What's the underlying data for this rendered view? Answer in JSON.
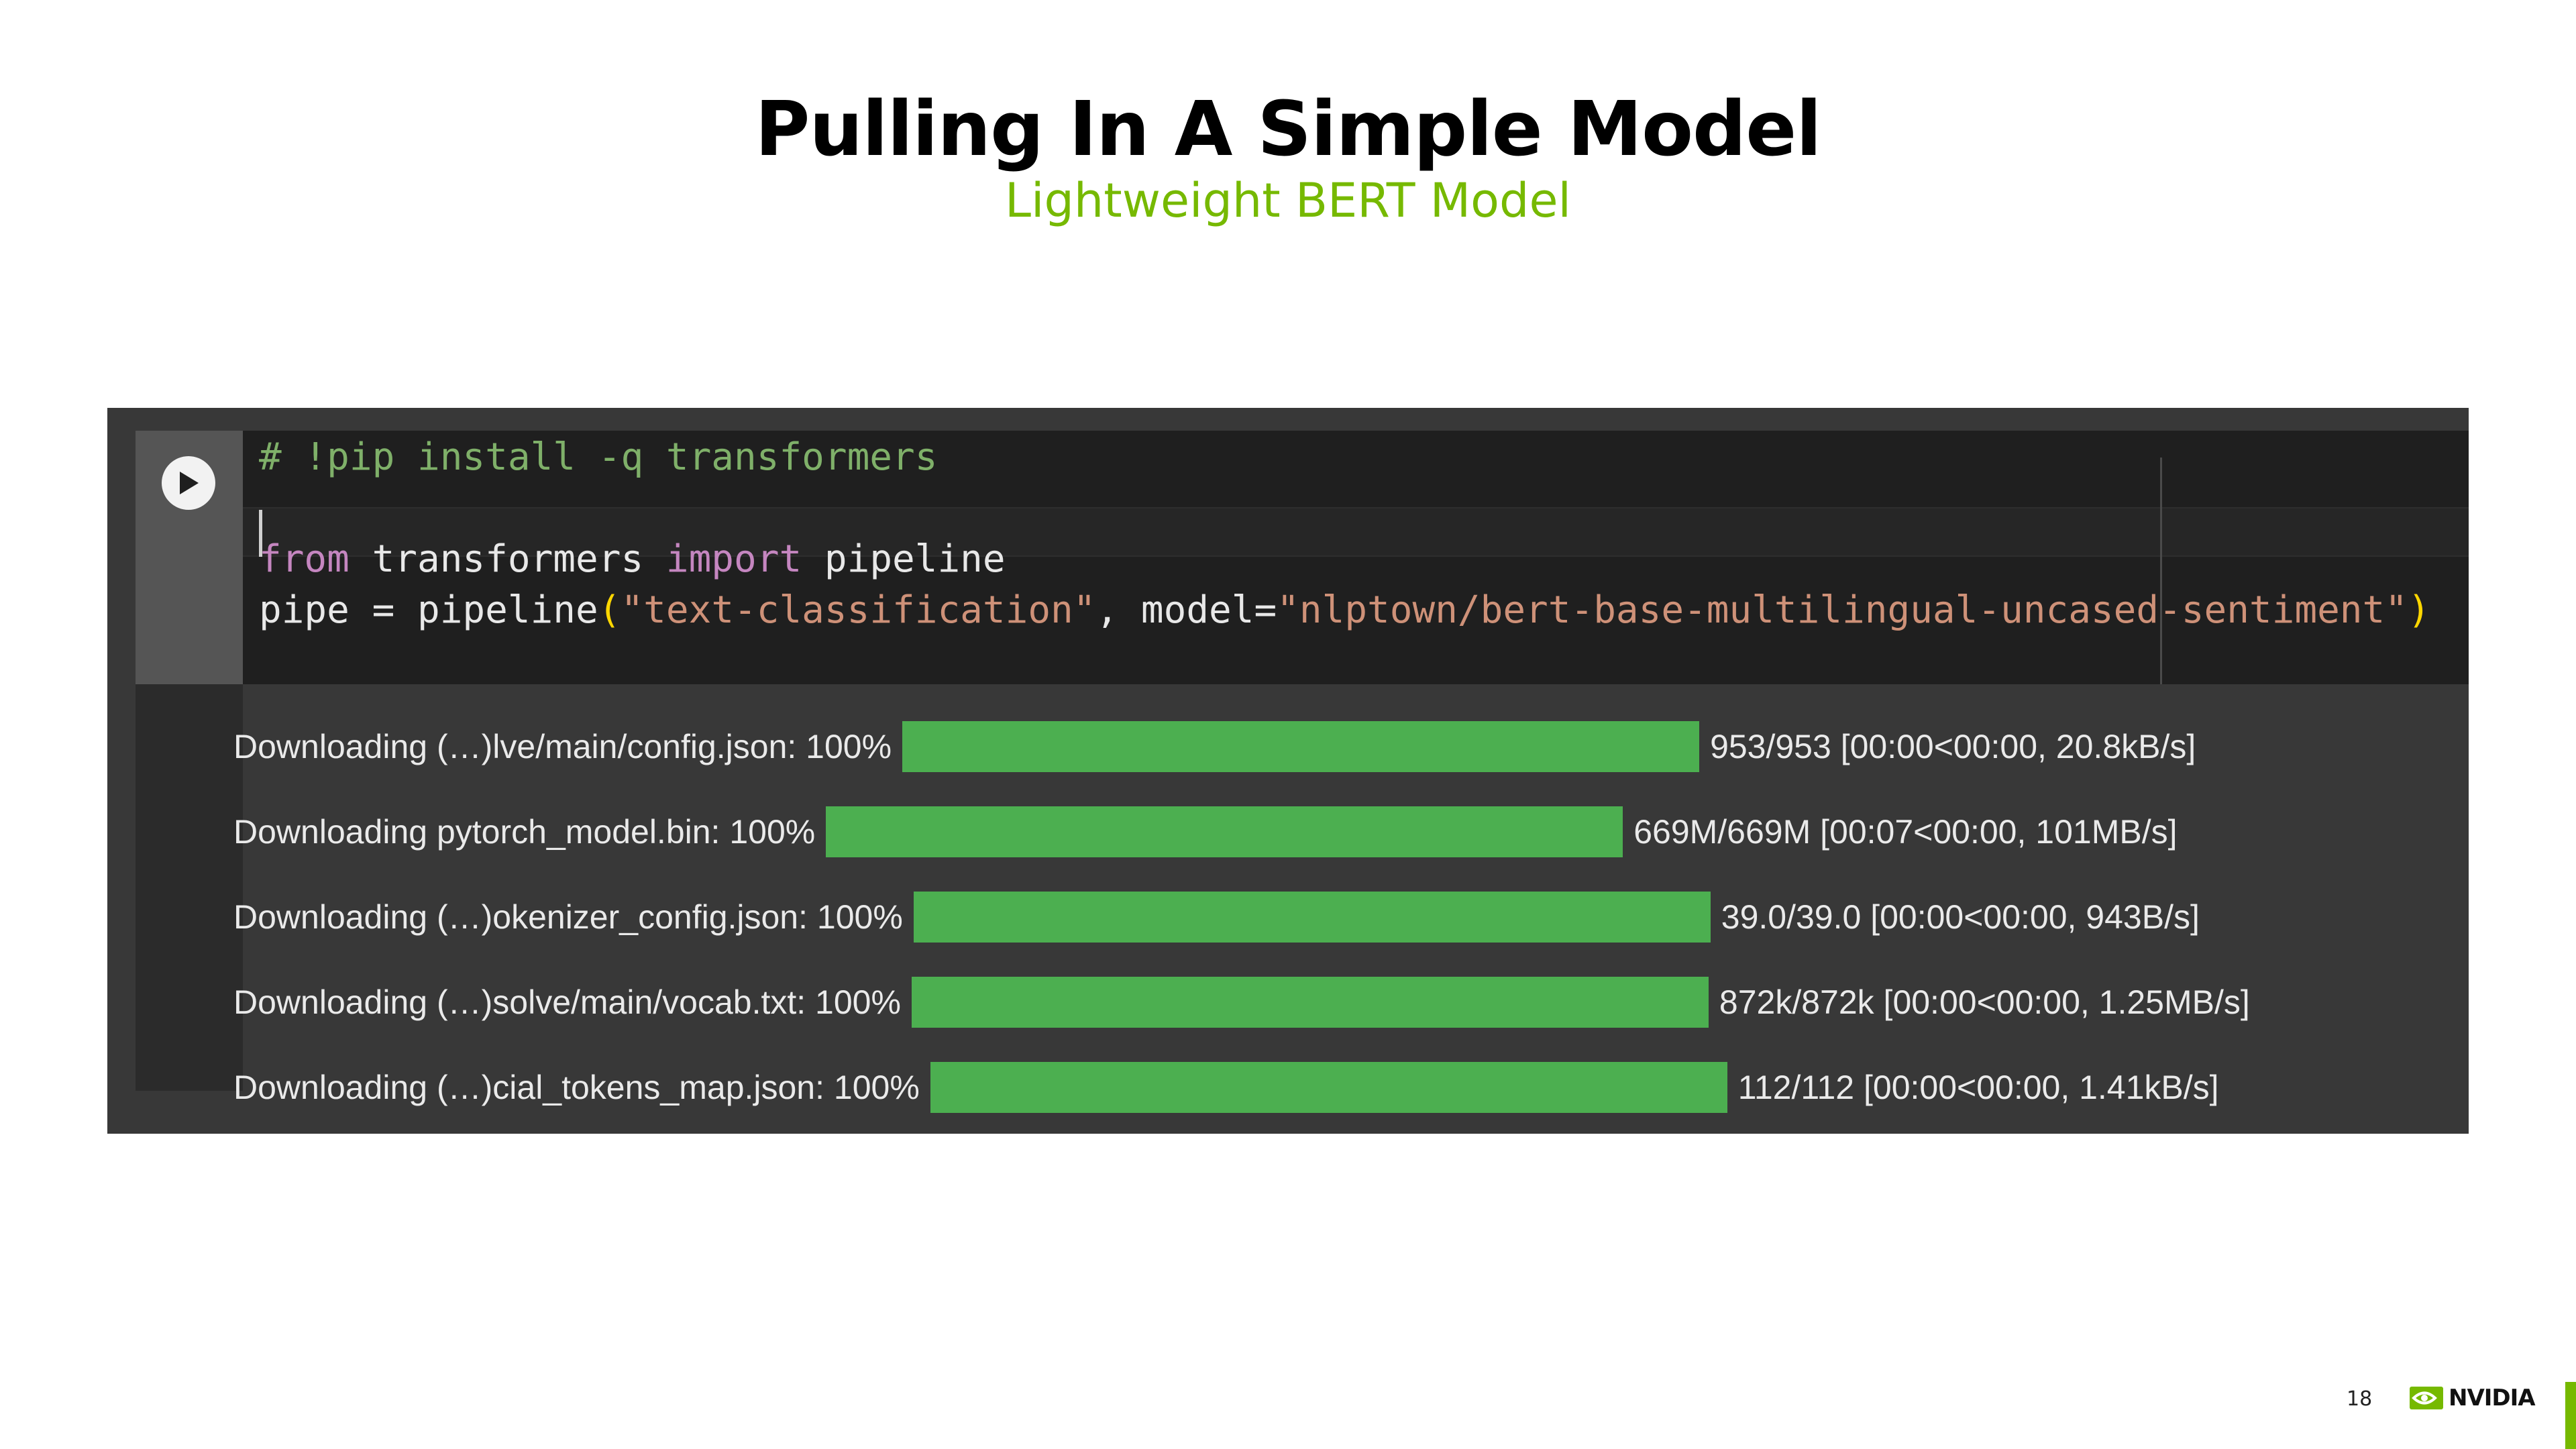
{
  "slide": {
    "title": "Pulling In A Simple Model",
    "subtitle": "Lightweight BERT Model",
    "page_number": "18",
    "logo_text": "NVIDIA",
    "accent_color": "#76b900"
  },
  "cell": {
    "run_icon": "play-icon",
    "code": {
      "line1": "# !pip install -q transformers",
      "line3_kw1": "from",
      "line3_mid": " transformers ",
      "line3_kw2": "import",
      "line3_end": " pipeline",
      "line4_a": "pipe = pipeline",
      "line4_paren_open": "(",
      "line4_str1": "\"text-classification\"",
      "line4_b": ", model=",
      "line4_str2": "\"nlptown/bert-base-multilingual-uncased-sentiment\"",
      "line4_paren_close": ")"
    },
    "progress_color": "#4caf50",
    "downloads": [
      {
        "label": "Downloading (…)lve/main/config.json: 100%",
        "progress": 1.0,
        "stats": "953/953 [00:00<00:00, 20.8kB/s]"
      },
      {
        "label": "Downloading pytorch_model.bin: 100%",
        "progress": 1.0,
        "stats": "669M/669M [00:07<00:00, 101MB/s]"
      },
      {
        "label": "Downloading (…)okenizer_config.json: 100%",
        "progress": 1.0,
        "stats": "39.0/39.0 [00:00<00:00, 943B/s]"
      },
      {
        "label": "Downloading (…)solve/main/vocab.txt: 100%",
        "progress": 1.0,
        "stats": "872k/872k [00:00<00:00, 1.25MB/s]"
      },
      {
        "label": "Downloading (…)cial_tokens_map.json: 100%",
        "progress": 1.0,
        "stats": "112/112 [00:00<00:00, 1.41kB/s]"
      }
    ]
  }
}
